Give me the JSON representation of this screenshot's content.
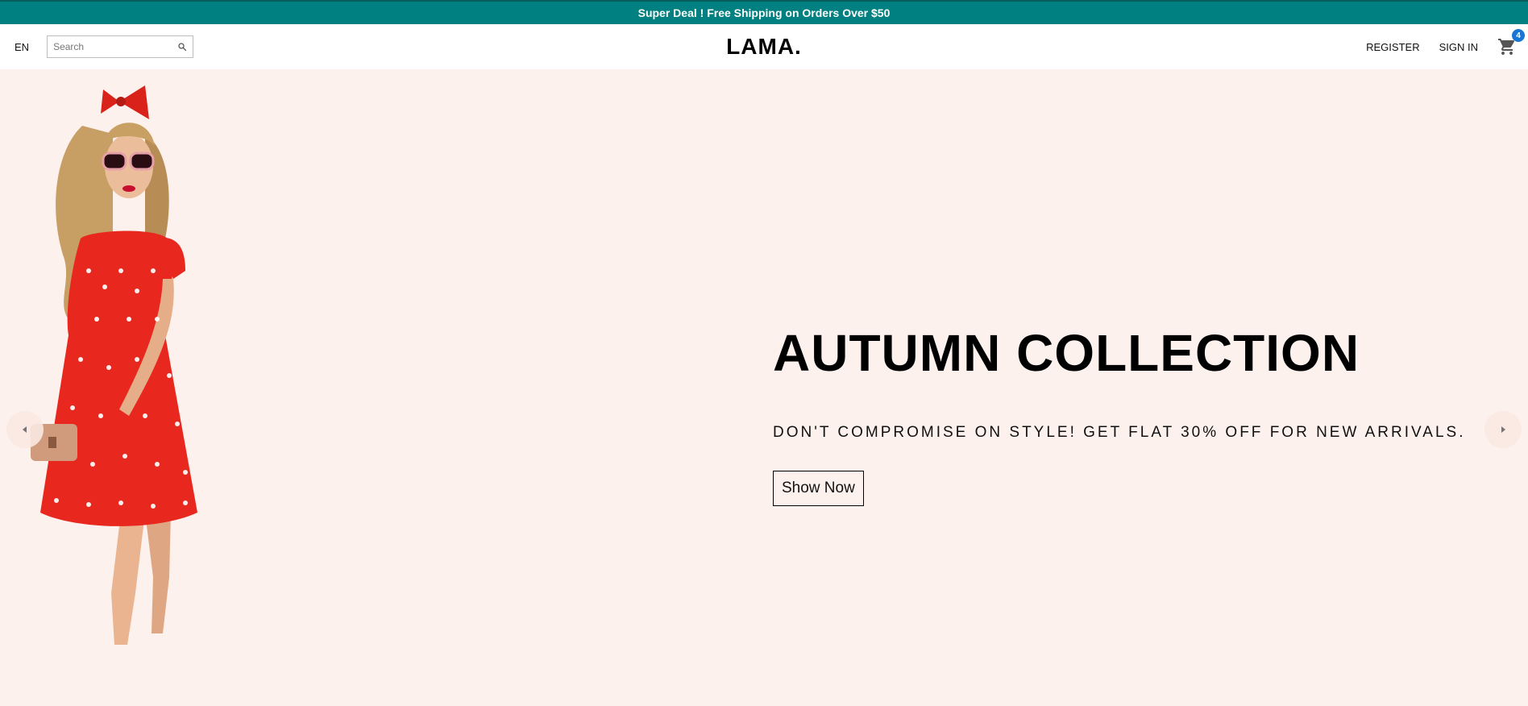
{
  "announcement": {
    "text": "Super Deal ! Free Shipping on Orders Over $50"
  },
  "navbar": {
    "language": "EN",
    "search": {
      "placeholder": "Search",
      "icon": "search-icon"
    },
    "logo": "LAMA.",
    "menu": {
      "register": "REGISTER",
      "sign_in": "SIGN IN"
    },
    "cart": {
      "icon": "shopping-cart-icon",
      "count": "4"
    }
  },
  "slide": {
    "title": "AUTUMN COLLECTION",
    "description": "DON'T COMPROMISE ON STYLE! GET FLAT 30% OFF FOR NEW ARRIVALS.",
    "button": "Show Now",
    "image": "woman-in-red-polka-dot-dress"
  },
  "colors": {
    "announcement_bg": "#008080",
    "slide_bg": "#fcf1ed",
    "badge": "#1976d2",
    "dress_red": "#e8281e"
  }
}
